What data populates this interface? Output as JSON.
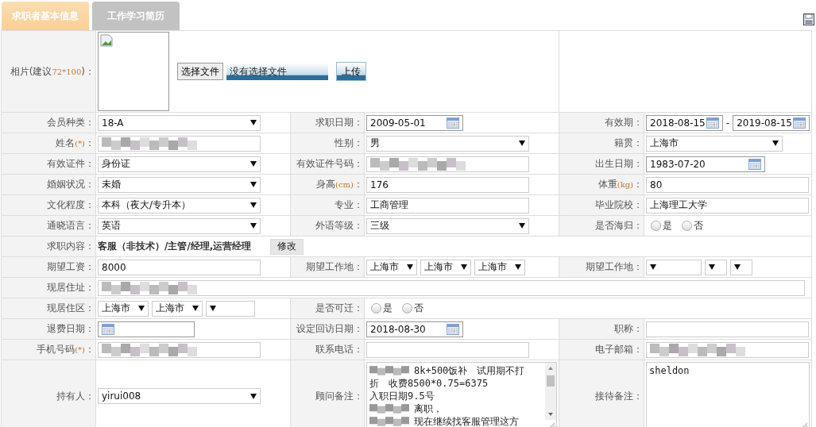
{
  "tabs": [
    {
      "label": "求职者基本信息",
      "selected": true
    },
    {
      "label": "工作学习简历",
      "selected": false
    }
  ],
  "rows": [
    {
      "cells": [
        {
          "kind": "label",
          "text": "相片(建议",
          "note": "72*100",
          "after": ")："
        },
        {
          "kind": "photo",
          "choose_button": "选择文件",
          "file_status": "没有选择文件",
          "upload_button": "上传"
        }
      ]
    },
    {
      "cells": [
        {
          "kind": "label",
          "text": "会员种类："
        },
        {
          "kind": "select",
          "value": "18-A"
        },
        {
          "kind": "label",
          "text": "求职日期："
        },
        {
          "kind": "date",
          "value": "2009-05-01"
        },
        {
          "kind": "label",
          "text": "有效期："
        },
        {
          "kind": "daterange",
          "from": "2018-08-15",
          "separator": "-",
          "to": "2019-08-15"
        }
      ]
    },
    {
      "cells": [
        {
          "kind": "label",
          "text": "姓名",
          "note": "(*)",
          "after": "："
        },
        {
          "kind": "input",
          "redacted": true
        },
        {
          "kind": "label",
          "text": "性别："
        },
        {
          "kind": "select",
          "value": "男"
        },
        {
          "kind": "label",
          "text": "籍贯："
        },
        {
          "kind": "select",
          "value": "上海市"
        }
      ]
    },
    {
      "cells": [
        {
          "kind": "label",
          "text": "有效证件："
        },
        {
          "kind": "select",
          "value": "身份证"
        },
        {
          "kind": "label",
          "text": "有效证件号码："
        },
        {
          "kind": "input",
          "redacted": true
        },
        {
          "kind": "label",
          "text": "出生日期："
        },
        {
          "kind": "date",
          "value": "1983-07-20"
        }
      ]
    },
    {
      "cells": [
        {
          "kind": "label",
          "text": "婚姻状况："
        },
        {
          "kind": "select",
          "value": "未婚"
        },
        {
          "kind": "label",
          "text": "身高",
          "note": "(cm)",
          "after": "："
        },
        {
          "kind": "input",
          "value": "176"
        },
        {
          "kind": "label",
          "text": "体重",
          "note": "(kg)",
          "after": "："
        },
        {
          "kind": "input",
          "value": "80"
        }
      ]
    },
    {
      "cells": [
        {
          "kind": "label",
          "text": "文化程度："
        },
        {
          "kind": "select",
          "value": "本科（夜大/专升本）"
        },
        {
          "kind": "label",
          "text": "专业："
        },
        {
          "kind": "input",
          "value": "工商管理"
        },
        {
          "kind": "label",
          "text": "毕业院校："
        },
        {
          "kind": "input",
          "value": "上海理工大学"
        }
      ]
    },
    {
      "cells": [
        {
          "kind": "label",
          "text": "通晓语言："
        },
        {
          "kind": "select",
          "value": "英语"
        },
        {
          "kind": "label",
          "text": "外语等级："
        },
        {
          "kind": "select",
          "value": "三级"
        },
        {
          "kind": "label",
          "text": "是否海归："
        },
        {
          "kind": "radio",
          "options": [
            {
              "label": "是",
              "selected": false
            },
            {
              "label": "否",
              "selected": false
            }
          ]
        }
      ]
    },
    {
      "cells": [
        {
          "kind": "label",
          "text": "求职内容："
        },
        {
          "kind": "jobs",
          "text": "客服（非技术）/主管/经理,运营经理",
          "button": "修改"
        }
      ]
    },
    {
      "cells": [
        {
          "kind": "label",
          "text": "期望工资："
        },
        {
          "kind": "input",
          "value": "8000"
        },
        {
          "kind": "label",
          "text": "期望工作地："
        },
        {
          "kind": "selects",
          "items": [
            {
              "value": "上海市"
            },
            {
              "value": "上海市"
            },
            {
              "value": "上海市"
            }
          ]
        },
        {
          "kind": "label",
          "text": "期望工作地："
        },
        {
          "kind": "selects",
          "items": [
            {
              "blank": true
            },
            {
              "blank": true
            },
            {
              "blank": true
            }
          ]
        }
      ]
    },
    {
      "cells": [
        {
          "kind": "label",
          "text": "现居住址："
        },
        {
          "kind": "input",
          "redacted": true
        }
      ]
    },
    {
      "cells": [
        {
          "kind": "label",
          "text": "现居住区："
        },
        {
          "kind": "selects",
          "items": [
            {
              "value": "上海市"
            },
            {
              "value": "上海市"
            },
            {
              "blank": true
            }
          ]
        },
        {
          "kind": "label",
          "text": "是否可迁："
        },
        {
          "kind": "radio",
          "options": [
            {
              "label": "是",
              "selected": false
            },
            {
              "label": "否",
              "selected": false
            }
          ]
        }
      ]
    },
    {
      "cells": [
        {
          "kind": "label",
          "text": "退费日期："
        },
        {
          "kind": "date"
        },
        {
          "kind": "label",
          "text": "设定回访日期："
        },
        {
          "kind": "date",
          "value": "2018-08-30"
        },
        {
          "kind": "label",
          "text": "职称："
        },
        {
          "kind": "input"
        }
      ]
    },
    {
      "cells": [
        {
          "kind": "label",
          "text": "手机号码",
          "note": "(*)",
          "after": "："
        },
        {
          "kind": "input",
          "redacted": true
        },
        {
          "kind": "label",
          "text": "联系电话："
        },
        {
          "kind": "input"
        },
        {
          "kind": "label",
          "text": "电子邮箱："
        },
        {
          "kind": "input",
          "redacted": true
        }
      ]
    },
    {
      "cells": [
        {
          "kind": "label",
          "text": "持有人："
        },
        {
          "kind": "select",
          "value": "yirui008"
        },
        {
          "kind": "label",
          "text": "顾问备注："
        },
        {
          "kind": "textarea",
          "scrollbar": true,
          "lines": [
            {
              "redacted": true,
              "text": "8k+500饭补　试用期不打"
            },
            {
              "redacted": false,
              "text": "折　收费8500*0.75=6375"
            },
            {
              "redacted": false,
              "text": "入职日期9.5号"
            },
            {
              "redacted": true,
              "text": "离职，"
            },
            {
              "redacted": true,
              "text": "现在继续找客服管理这方"
            }
          ]
        },
        {
          "kind": "label",
          "text": "接待备注："
        },
        {
          "kind": "textarea",
          "scrollbar": false,
          "lines": [
            {
              "redacted": false,
              "text": "sheldon"
            }
          ]
        }
      ]
    }
  ]
}
